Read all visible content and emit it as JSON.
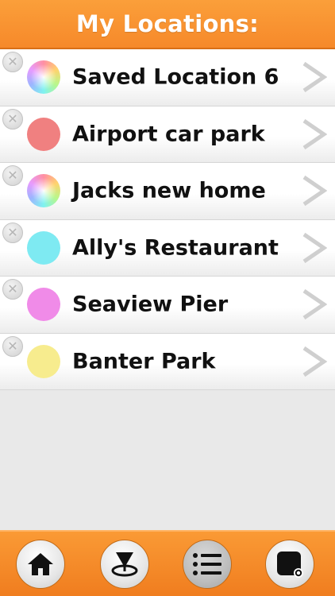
{
  "header": {
    "title": "My Locations:"
  },
  "locations": [
    {
      "name": "Saved Location 6",
      "color": "multicolor"
    },
    {
      "name": "Airport car park",
      "color": "#f08080"
    },
    {
      "name": "Jacks new home",
      "color": "multicolor"
    },
    {
      "name": "Ally's Restaurant",
      "color": "#7eeaf2"
    },
    {
      "name": "Seaview Pier",
      "color": "#f08be8"
    },
    {
      "name": "Banter Park",
      "color": "#f7ec8e"
    }
  ],
  "icons": {
    "delete": "x-circle-icon",
    "chevron": "chevron-right-icon"
  },
  "tabs": [
    {
      "icon": "home-icon",
      "active": false
    },
    {
      "icon": "map-pin-icon",
      "active": false
    },
    {
      "icon": "list-icon",
      "active": true
    },
    {
      "icon": "settings-icon",
      "active": false
    }
  ],
  "colors": {
    "accent": "#f6892a"
  }
}
